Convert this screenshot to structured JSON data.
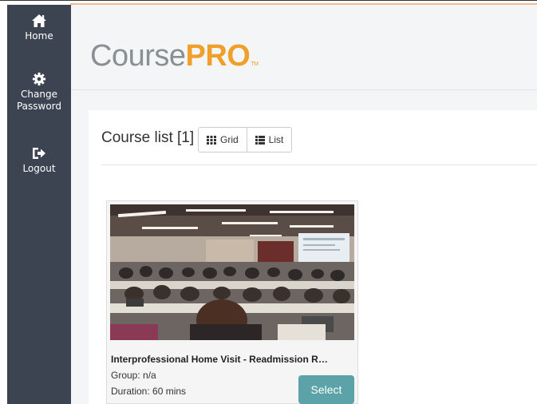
{
  "sidebar": {
    "items": [
      {
        "label": "Home",
        "icon": "home-icon"
      },
      {
        "label": "Change\nPassword",
        "icon": "gear-icon"
      },
      {
        "label": "Logout",
        "icon": "logout-icon"
      }
    ]
  },
  "header": {
    "logo_course": "Course",
    "logo_pro": "PRO",
    "logo_tm": "TM"
  },
  "course_list": {
    "title": "Course list [1]",
    "grid_label": "Grid",
    "list_label": "List"
  },
  "courses": [
    {
      "title": "Interprofessional Home Visit - Readmission R…",
      "group": "Group: n/a",
      "duration": "Duration: 60 mins",
      "select_label": "Select",
      "image": "lecture-hall-photo"
    }
  ],
  "colors": {
    "sidebar_bg": "#3c4451",
    "accent_orange": "#f0a02a",
    "logo_gray": "#8a8f94",
    "select_button": "#5ba3a8",
    "main_bg": "#f4f5f6"
  }
}
